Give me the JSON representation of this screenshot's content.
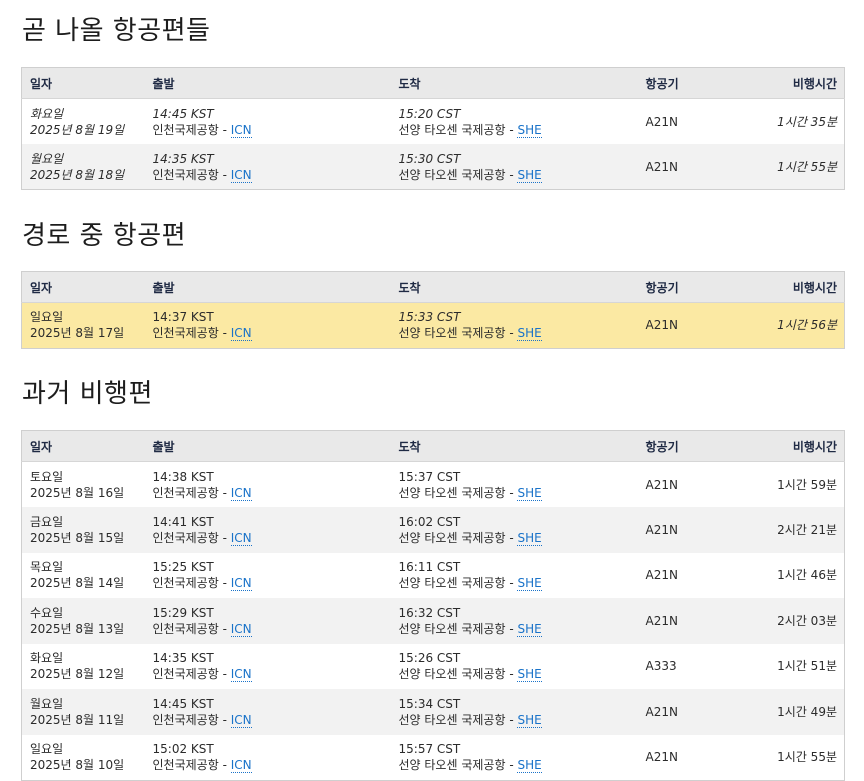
{
  "sections": {
    "upcoming": "곧 나올 항공편들",
    "en_route": "경로 중 항공편",
    "past": "과거 비행편"
  },
  "headers": {
    "date": "일자",
    "departure": "출발",
    "arrival": "도착",
    "aircraft": "항공기",
    "duration": "비행시간"
  },
  "airports": {
    "origin_name": "인천국제공항",
    "origin_code": "ICN",
    "dest_name": "선양 타오센 국제공항",
    "dest_code": "SHE",
    "separator": " - "
  },
  "upcoming": [
    {
      "weekday": "화요일",
      "date": "2025년 8월 19일",
      "dep_time": "14:45 KST",
      "arr_time": "15:20 CST",
      "aircraft": "A21N",
      "duration": "1시간 35분"
    },
    {
      "weekday": "월요일",
      "date": "2025년 8월 18일",
      "dep_time": "14:35 KST",
      "arr_time": "15:30 CST",
      "aircraft": "A21N",
      "duration": "1시간 55분"
    }
  ],
  "en_route": [
    {
      "weekday": "일요일",
      "date": "2025년 8월 17일",
      "dep_time": "14:37 KST",
      "arr_time": "15:33 CST",
      "aircraft": "A21N",
      "duration": "1시간 56분"
    }
  ],
  "past": [
    {
      "weekday": "토요일",
      "date": "2025년 8월 16일",
      "dep_time": "14:38 KST",
      "arr_time": "15:37 CST",
      "aircraft": "A21N",
      "duration": "1시간 59분"
    },
    {
      "weekday": "금요일",
      "date": "2025년 8월 15일",
      "dep_time": "14:41 KST",
      "arr_time": "16:02 CST",
      "aircraft": "A21N",
      "duration": "2시간 21분"
    },
    {
      "weekday": "목요일",
      "date": "2025년 8월 14일",
      "dep_time": "15:25 KST",
      "arr_time": "16:11 CST",
      "aircraft": "A21N",
      "duration": "1시간 46분"
    },
    {
      "weekday": "수요일",
      "date": "2025년 8월 13일",
      "dep_time": "15:29 KST",
      "arr_time": "16:32 CST",
      "aircraft": "A21N",
      "duration": "2시간 03분"
    },
    {
      "weekday": "화요일",
      "date": "2025년 8월 12일",
      "dep_time": "14:35 KST",
      "arr_time": "15:26 CST",
      "aircraft": "A333",
      "duration": "1시간 51분"
    },
    {
      "weekday": "월요일",
      "date": "2025년 8월 11일",
      "dep_time": "14:45 KST",
      "arr_time": "15:34 CST",
      "aircraft": "A21N",
      "duration": "1시간 49분"
    },
    {
      "weekday": "일요일",
      "date": "2025년 8월 10일",
      "dep_time": "15:02 KST",
      "arr_time": "15:57 CST",
      "aircraft": "A21N",
      "duration": "1시간 55분"
    }
  ],
  "colors": {
    "header_bg": "#e9e9e9",
    "row_alt_bg": "#f2f2f2",
    "en_route_bg": "#fbe9a3",
    "link": "#1a73c9"
  }
}
